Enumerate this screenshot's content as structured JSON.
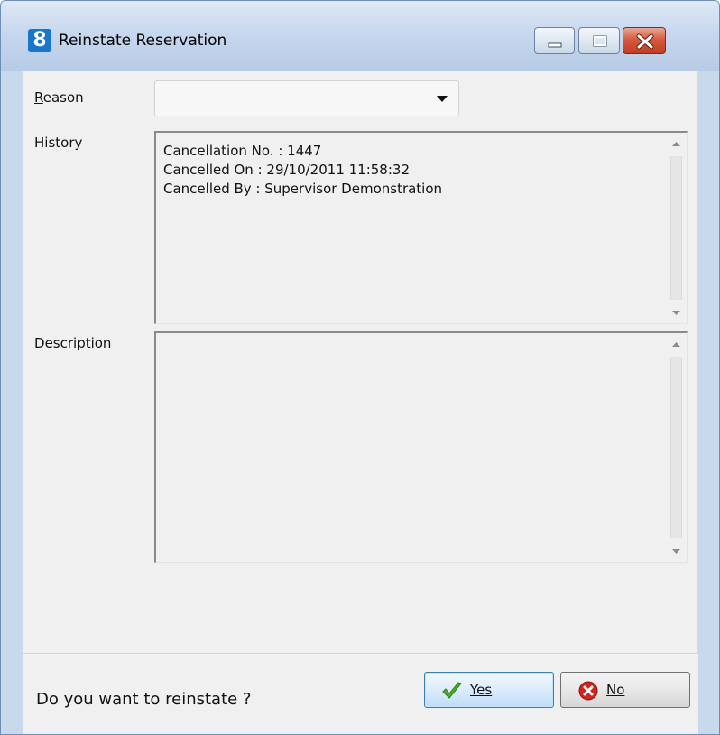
{
  "window": {
    "title": "Reinstate Reservation",
    "app_icon_glyph": "8",
    "controls": [
      "minimize",
      "maximize",
      "close"
    ]
  },
  "form": {
    "reason": {
      "label": "Reason",
      "value": ""
    },
    "history": {
      "label": "History",
      "lines": [
        "Cancellation No. : 1447",
        "Cancelled On : 29/10/2011 11:58:32",
        "Cancelled By : Supervisor Demonstration"
      ]
    },
    "description": {
      "label": "Description",
      "value": ""
    }
  },
  "footer": {
    "prompt": "Do you want to reinstate ?",
    "yes_label": "Yes",
    "no_label": "No"
  },
  "colors": {
    "titlebar": "#c7d8ee",
    "close_button": "#d65a3f",
    "yes_icon": "#4caf2a",
    "no_icon": "#d32222"
  }
}
